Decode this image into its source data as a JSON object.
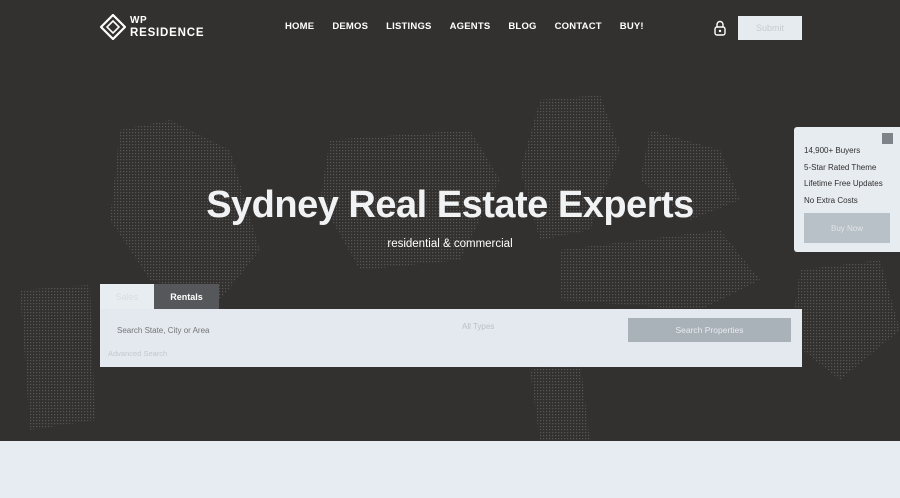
{
  "header": {
    "logo_line1": "WP",
    "logo_line2": "RESIDENCE",
    "nav": [
      "HOME",
      "DEMOS",
      "LISTINGS",
      "AGENTS",
      "BLOG",
      "CONTACT",
      "BUY!"
    ],
    "submit_label": "Submit"
  },
  "hero": {
    "title": "Sydney Real Estate Experts",
    "subtitle": "residential & commercial"
  },
  "search": {
    "tabs": [
      "Sales",
      "Rentals"
    ],
    "active_tab": "Rentals",
    "keyword_placeholder": "Search State, City or Area",
    "type_value": "All Types",
    "search_button": "Search Properties",
    "advanced_link": "Advanced Search"
  },
  "side_widget": {
    "features": [
      "14,900+ Buyers",
      "5-Star Rated Theme",
      "Lifetime Free Updates",
      "No Extra Costs"
    ],
    "button_label": "Buy Now"
  },
  "colors": {
    "hero_bg": "#3b3938",
    "page_bg": "#e6ecf1",
    "panel_bg": "#e3e9ee",
    "active_tab_bg": "#56575a"
  }
}
